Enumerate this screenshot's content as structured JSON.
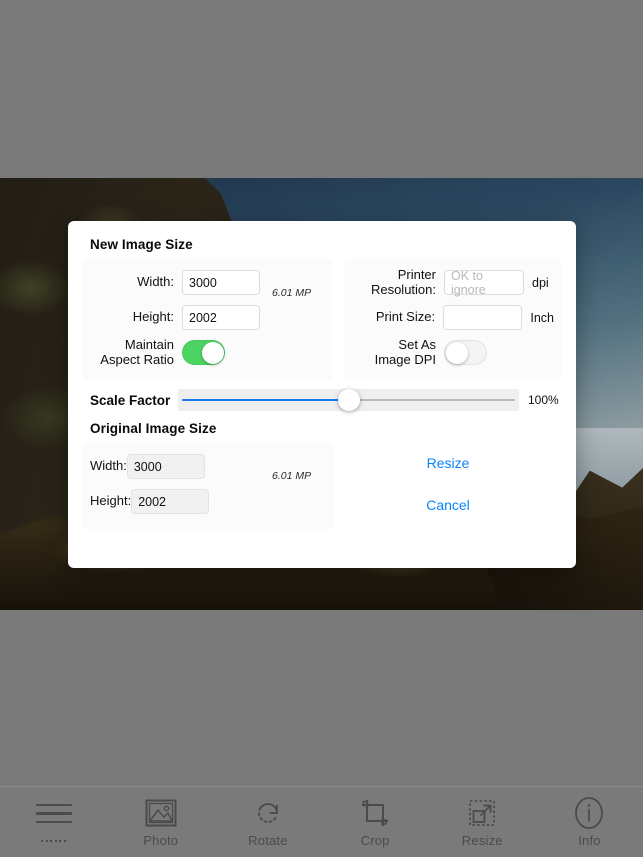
{
  "app": {
    "background_color": "#7a7a7a",
    "photo": {
      "name": "cliff-seascape-photo"
    }
  },
  "dialog": {
    "new_image_size": {
      "title": "New Image Size",
      "width_label": "Width:",
      "width_value": "3000",
      "height_label": "Height:",
      "height_value": "2002",
      "megapixels": "6.01 MP",
      "maintain_aspect_label": "Maintain\nAspect Ratio",
      "maintain_aspect_line1": "Maintain",
      "maintain_aspect_line2": "Aspect Ratio",
      "maintain_aspect_on": true
    },
    "print_settings": {
      "printer_resolution_line1": "Printer",
      "printer_resolution_line2": "Resolution:",
      "printer_resolution_value": "",
      "printer_resolution_placeholder": "OK to ignore",
      "printer_resolution_unit": "dpi",
      "print_size_label": "Print Size:",
      "print_size_value": "",
      "print_size_unit": "Inch",
      "set_as_image_dpi_line1": "Set As",
      "set_as_image_dpi_line2": "Image DPI",
      "set_as_image_dpi_on": false
    },
    "scale_factor": {
      "label": "Scale Factor",
      "value_label": "100%",
      "value": 100,
      "min": 0,
      "max": 200,
      "fill_color": "#1a7cf0",
      "track_color": "#b9b9b9"
    },
    "original_image_size": {
      "title": "Original Image Size",
      "width_label": "Width:",
      "width_value": "3000",
      "height_label": "Height:",
      "height_value": "2002",
      "megapixels": "6.01 MP"
    },
    "actions": {
      "resize_label": "Resize",
      "cancel_label": "Cancel",
      "link_color": "#0a84ff"
    }
  },
  "toolbar": {
    "items": [
      {
        "label": "......",
        "icon": "hamburger-menu-icon"
      },
      {
        "label": "Photo",
        "icon": "photo-icon"
      },
      {
        "label": "Rotate",
        "icon": "rotate-icon"
      },
      {
        "label": "Crop",
        "icon": "crop-icon"
      },
      {
        "label": "Resize",
        "icon": "resize-icon"
      },
      {
        "label": "Info",
        "icon": "info-icon"
      }
    ]
  }
}
